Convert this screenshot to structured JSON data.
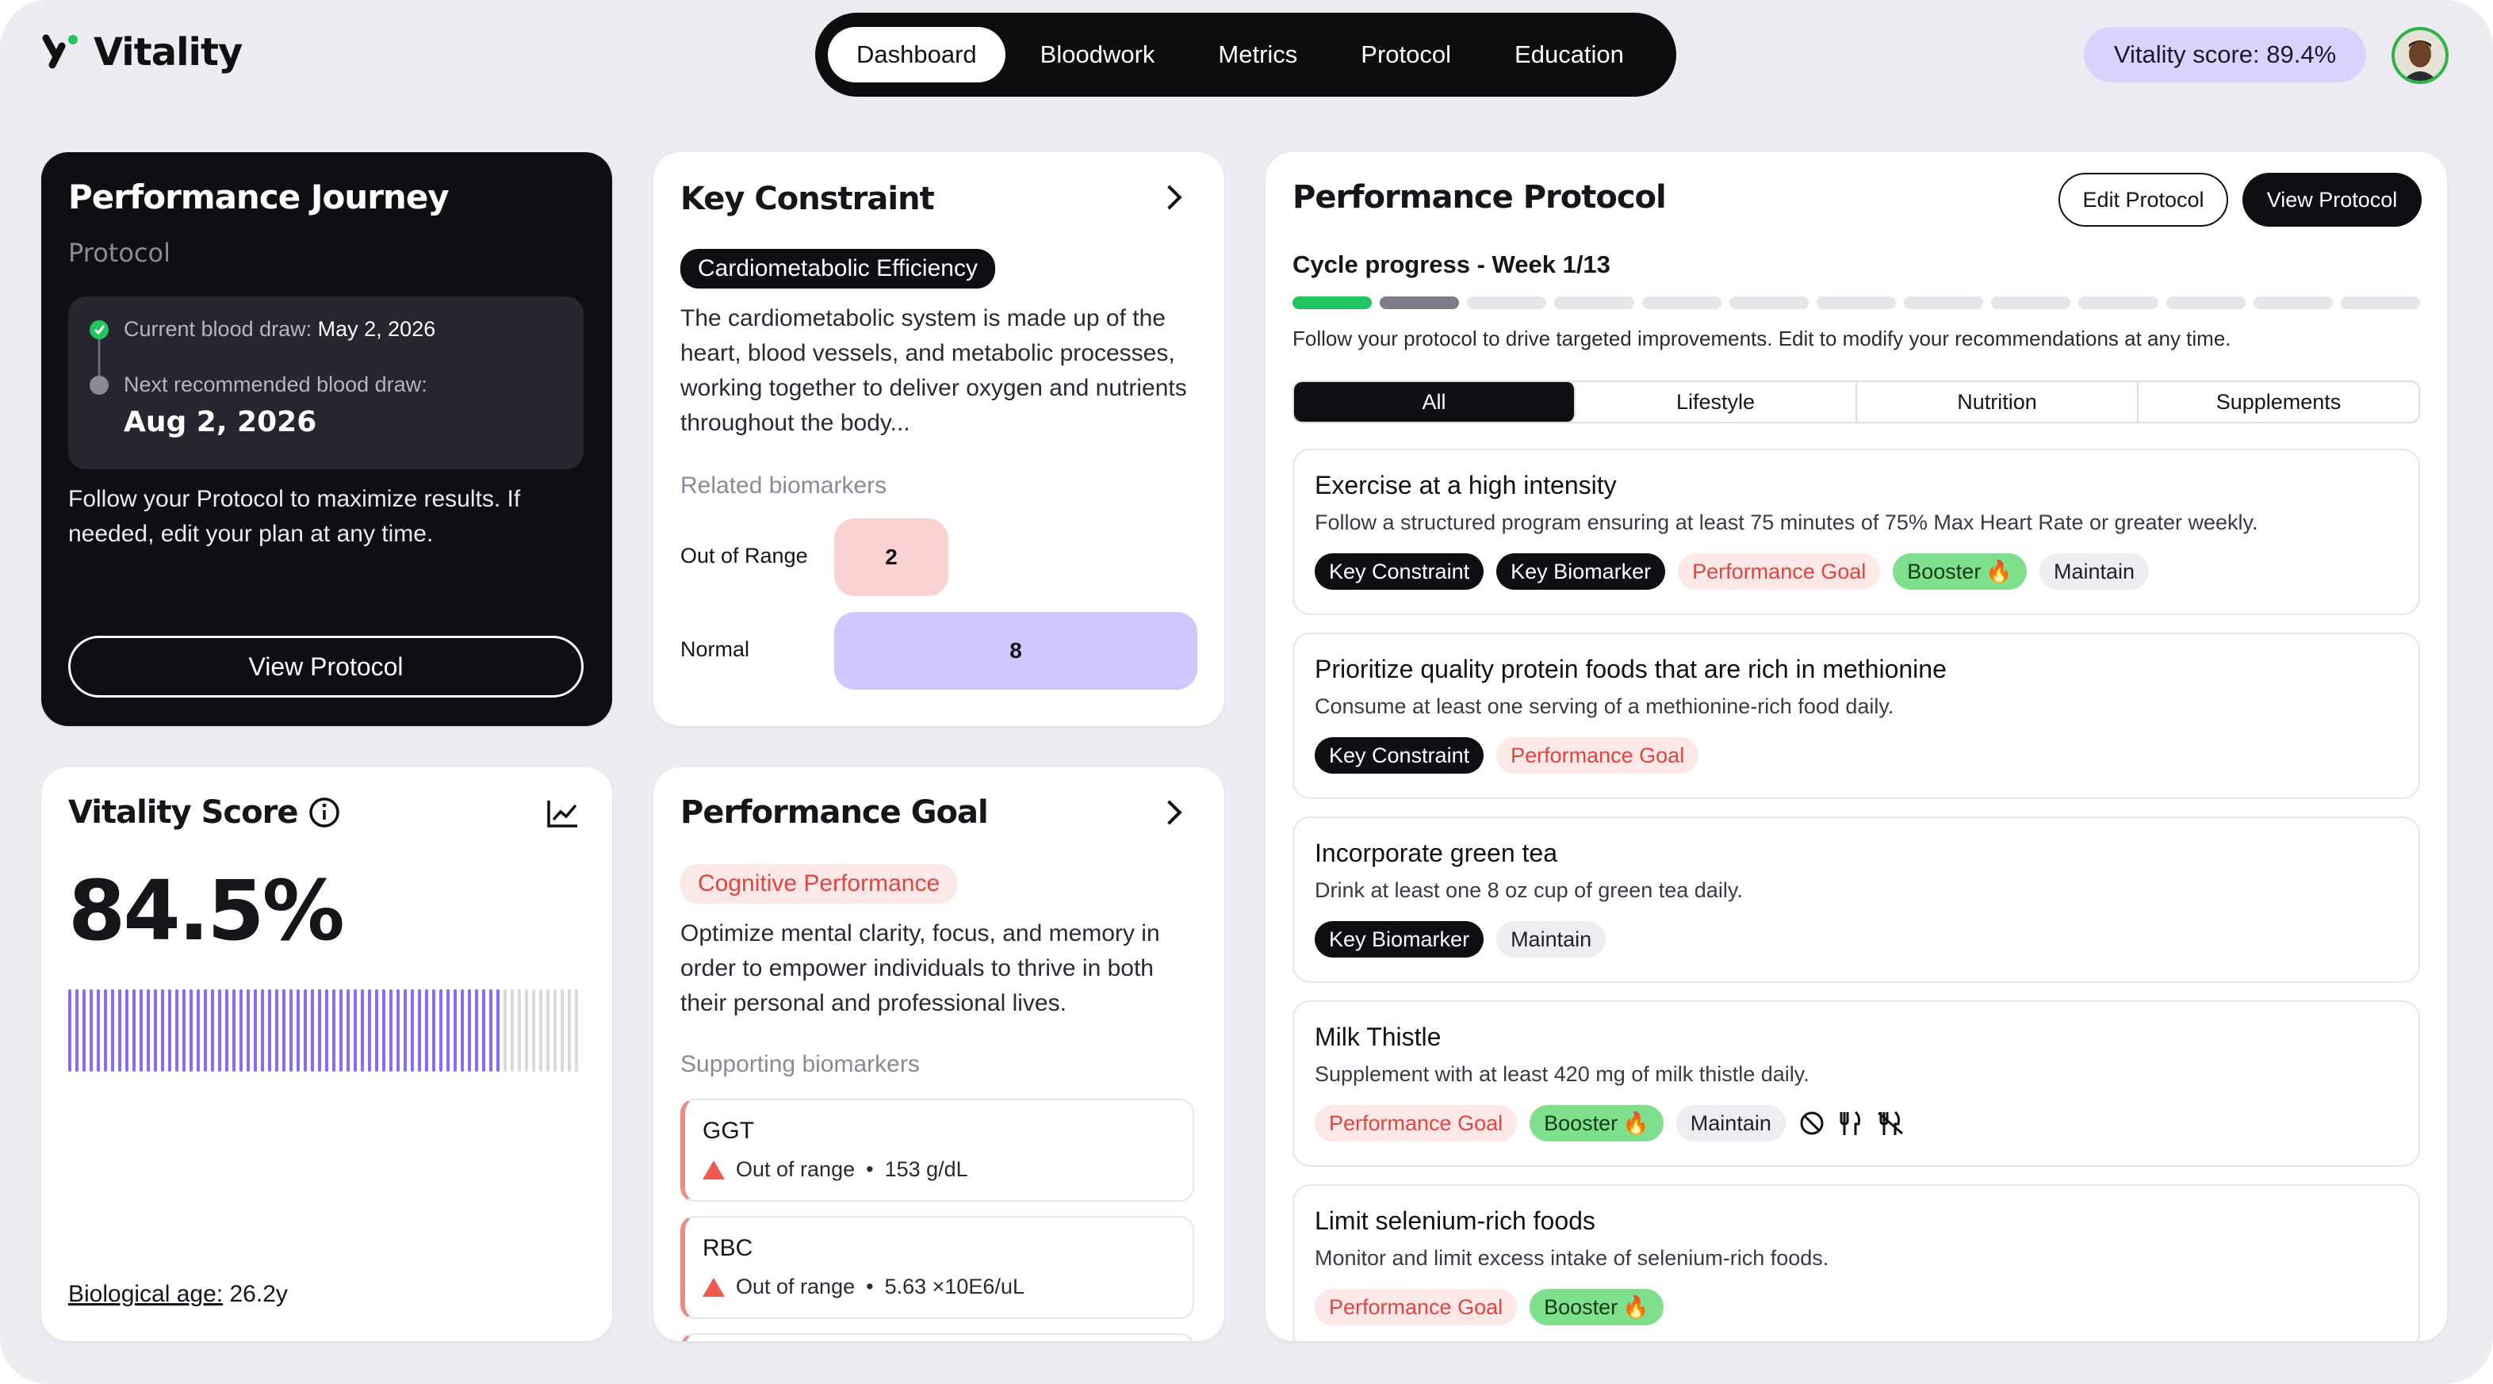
{
  "app": {
    "logo_text": "Vitality",
    "nav_tabs": [
      "Dashboard",
      "Bloodwork",
      "Metrics",
      "Protocol",
      "Education"
    ],
    "active_tab": "Dashboard",
    "score_pill": "Vitality score: 89.4%"
  },
  "journey": {
    "title": "Performance Journey",
    "subtitle": "Protocol",
    "current_label": "Current blood draw:",
    "current_date": "May 2, 2026",
    "next_label": "Next recommended blood draw:",
    "next_date": "Aug 2, 2026",
    "body": "Follow your Protocol to maximize results. If needed, edit your plan at any time.",
    "button": "View Protocol"
  },
  "vitality": {
    "title": "Vitality Score",
    "value": "84.5%",
    "fill_fraction": 0.845,
    "bio_age_label": "Biological age:",
    "bio_age_value": "26.2y"
  },
  "constraint": {
    "title": "Key Constraint",
    "badge": "Cardiometabolic Efficiency",
    "body": "The cardiometabolic system is made up of the heart, blood vessels, and metabolic processes, working together to deliver oxygen and nutrients throughout the body...",
    "related_label": "Related biomarkers",
    "out_label": "Out of Range",
    "out_value": "2",
    "normal_label": "Normal",
    "normal_value": "8"
  },
  "goal": {
    "title": "Performance Goal",
    "badge": "Cognitive Performance",
    "body": "Optimize mental clarity, focus, and memory in order to empower individuals to thrive in both their personal and professional lives.",
    "supporting_label": "Supporting biomarkers",
    "items": [
      {
        "name": "GGT",
        "status": "Out of range",
        "value": "153 g/dL"
      },
      {
        "name": "RBC",
        "status": "Out of range",
        "value": "5.63 ×10E6/uL"
      }
    ]
  },
  "protocol": {
    "title": "Performance Protocol",
    "edit_button": "Edit Protocol",
    "view_button": "View Protocol",
    "cycle_label": "Cycle progress - Week 1/13",
    "weeks_total": 13,
    "weeks_done": 1,
    "description": "Follow your protocol to drive targeted improvements. Edit to modify your recommendations at any time.",
    "filters": [
      "All",
      "Lifestyle",
      "Nutrition",
      "Supplements"
    ],
    "active_filter": "All",
    "recommendations": [
      {
        "title": "Exercise at a high intensity",
        "desc": "Follow a structured program ensuring at least 75 minutes of 75% Max Heart Rate or greater weekly.",
        "tags": [
          "Key Constraint",
          "Key Biomarker",
          "Performance Goal",
          "Booster",
          "Maintain"
        ]
      },
      {
        "title": "Prioritize quality protein foods that are rich in methionine",
        "desc": "Consume at least one serving of a methionine-rich food daily.",
        "tags": [
          "Key Constraint",
          "Performance Goal"
        ]
      },
      {
        "title": "Incorporate green tea",
        "desc": "Drink at least one 8 oz cup of green tea daily.",
        "tags": [
          "Key Biomarker",
          "Maintain"
        ]
      },
      {
        "title": "Milk Thistle",
        "desc": "Supplement with at least 420 mg of milk thistle daily.",
        "tags": [
          "Performance Goal",
          "Booster",
          "Maintain"
        ]
      },
      {
        "title": "Limit selenium-rich foods",
        "desc": "Monitor and limit excess intake of selenium-rich foods.",
        "tags": [
          "Performance Goal",
          "Booster"
        ]
      }
    ]
  },
  "colors": {
    "accent_purple": "#8b6cf0",
    "progress_green": "#22c55e",
    "warn_red": "#ef5a4f"
  },
  "icons": [
    "logo-mark-icon",
    "info-icon",
    "trend-chart-icon",
    "chevron-right-icon",
    "alert-triangle-icon",
    "fire-icon",
    "no-alcohol-icon",
    "fork-knife-icon",
    "no-food-icon"
  ]
}
